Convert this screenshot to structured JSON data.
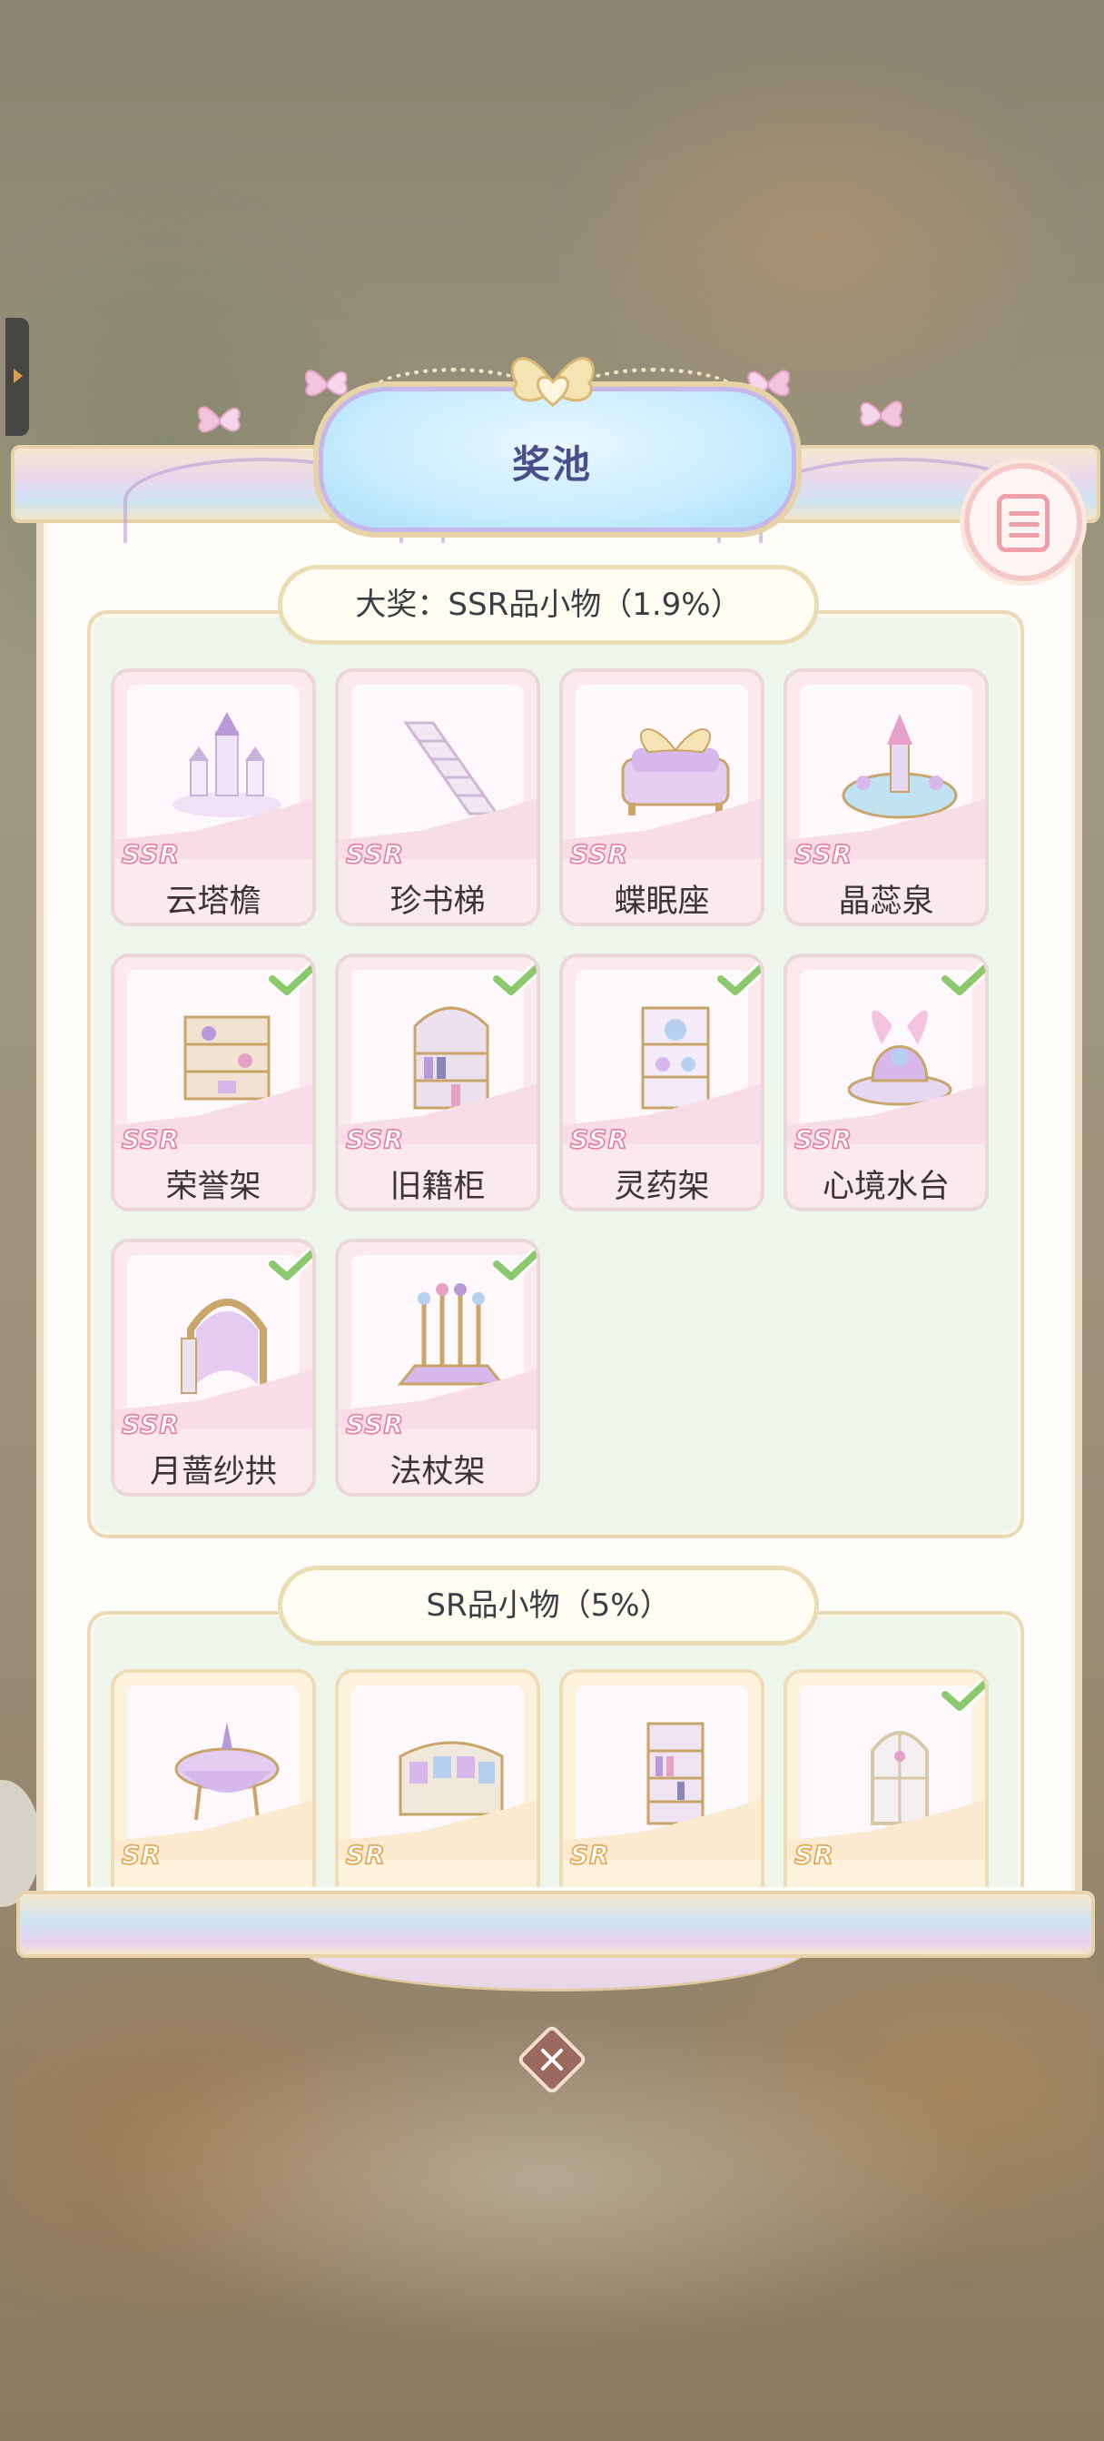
{
  "dialog": {
    "title": "奖池"
  },
  "sections": [
    {
      "header": "大奖：SSR品小物（1.9%）",
      "items": [
        {
          "name": "云塔檐",
          "rarity": "SSR",
          "owned": false
        },
        {
          "name": "珍书梯",
          "rarity": "SSR",
          "owned": false
        },
        {
          "name": "蝶眠座",
          "rarity": "SSR",
          "owned": false
        },
        {
          "name": "晶蕊泉",
          "rarity": "SSR",
          "owned": false
        },
        {
          "name": "荣誉架",
          "rarity": "SSR",
          "owned": true
        },
        {
          "name": "旧籍柜",
          "rarity": "SSR",
          "owned": true
        },
        {
          "name": "灵药架",
          "rarity": "SSR",
          "owned": true
        },
        {
          "name": "心境水台",
          "rarity": "SSR",
          "owned": true
        },
        {
          "name": "月蔷纱拱",
          "rarity": "SSR",
          "owned": true
        },
        {
          "name": "法杖架",
          "rarity": "SSR",
          "owned": true
        }
      ]
    },
    {
      "header": "SR品小物（5%）",
      "items": [
        {
          "name": "",
          "rarity": "SR",
          "owned": false
        },
        {
          "name": "",
          "rarity": "SR",
          "owned": false
        },
        {
          "name": "",
          "rarity": "SR",
          "owned": false
        },
        {
          "name": "",
          "rarity": "SR",
          "owned": true
        }
      ]
    }
  ],
  "icons": {
    "list": "list-icon",
    "close": "close-icon",
    "owned": "check-icon",
    "ornament": "heart-bow-icon"
  },
  "colors": {
    "title_text": "#4a4f8a",
    "ssr_card": "#fbe9ee",
    "sr_card": "#fdf3dd",
    "section_bg": "#eef6ec",
    "check": "#8cc86e"
  }
}
